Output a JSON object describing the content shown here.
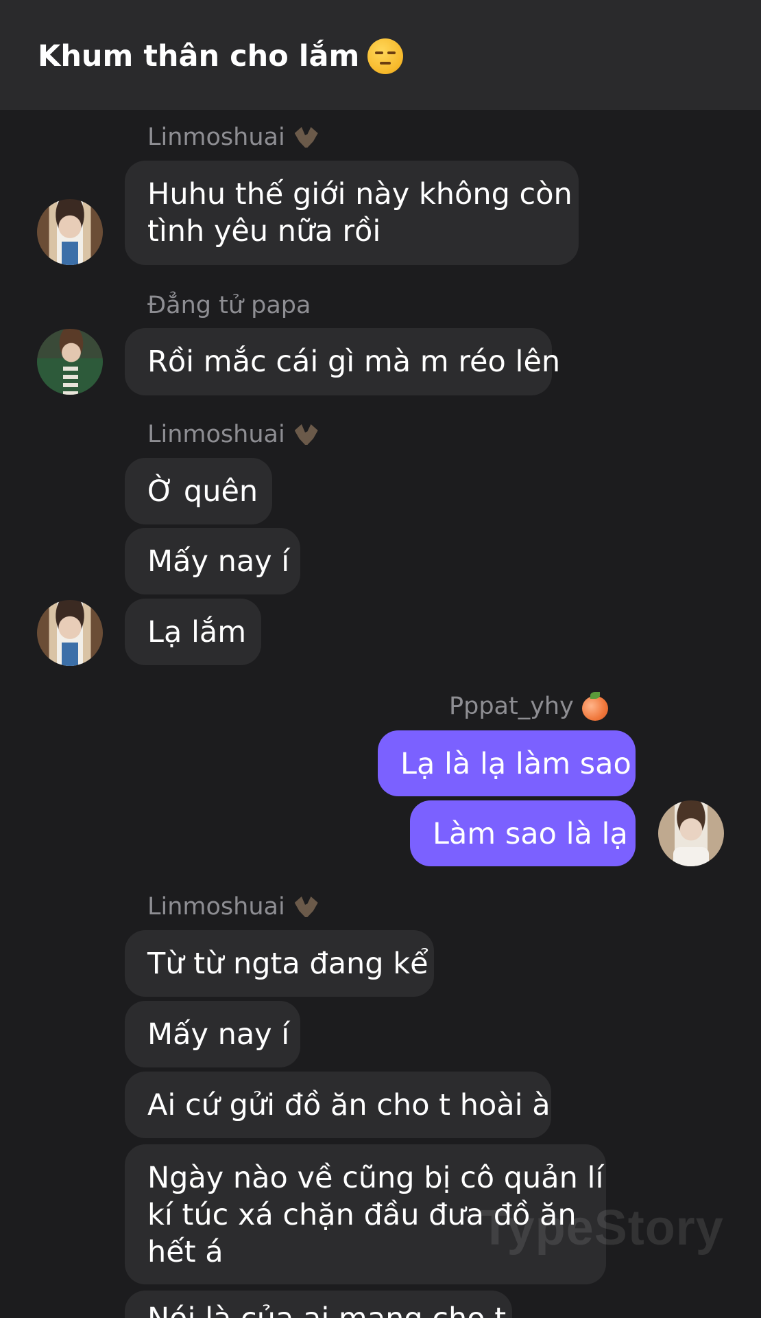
{
  "header": {
    "title": "Khum thân cho lắm",
    "title_emoji": "unamused-face-icon"
  },
  "colors": {
    "background": "#1c1c1e",
    "header_background": "#2a2a2c",
    "incoming_bubble": "#2c2c2e",
    "outgoing_bubble": "#7b61ff",
    "sender_name": "#8e8e93"
  },
  "messages": [
    {
      "sender": "Linmoshuai",
      "sender_icon": "bat-icon",
      "direction": "incoming",
      "bubbles": [
        {
          "lines": [
            "Huhu thế giới này không còn",
            "tình yêu nữa rồi"
          ]
        }
      ]
    },
    {
      "sender": "Đẳng tử papa",
      "direction": "incoming",
      "bubbles": [
        {
          "lines": [
            "Rồi mắc cái gì mà m réo lên"
          ]
        }
      ]
    },
    {
      "sender": "Linmoshuai",
      "sender_icon": "bat-icon",
      "direction": "incoming",
      "bubbles": [
        {
          "lines": [
            "Ờ quên"
          ]
        },
        {
          "lines": [
            "Mấy nay í"
          ]
        },
        {
          "lines": [
            "Lạ lắm"
          ]
        }
      ]
    },
    {
      "sender": "Pppat_yhy",
      "sender_icon": "peach-icon",
      "direction": "outgoing",
      "bubbles": [
        {
          "lines": [
            "Lạ là lạ làm sao"
          ]
        },
        {
          "lines": [
            "Làm sao là lạ"
          ]
        }
      ]
    },
    {
      "sender": "Linmoshuai",
      "sender_icon": "bat-icon",
      "direction": "incoming",
      "bubbles": [
        {
          "lines": [
            "Từ từ ngta đang kể"
          ]
        },
        {
          "lines": [
            "Mấy nay í"
          ]
        },
        {
          "lines": [
            "Ai cứ gửi đồ ăn cho t hoài à"
          ]
        },
        {
          "lines": [
            "Ngày nào về cũng bị cô quản lí",
            "kí túc xá chặn đầu đưa đồ ăn",
            "hết á"
          ]
        },
        {
          "lines": [
            "Nói là của ai mang cho t"
          ]
        }
      ]
    }
  ],
  "watermark": "TypeStory"
}
